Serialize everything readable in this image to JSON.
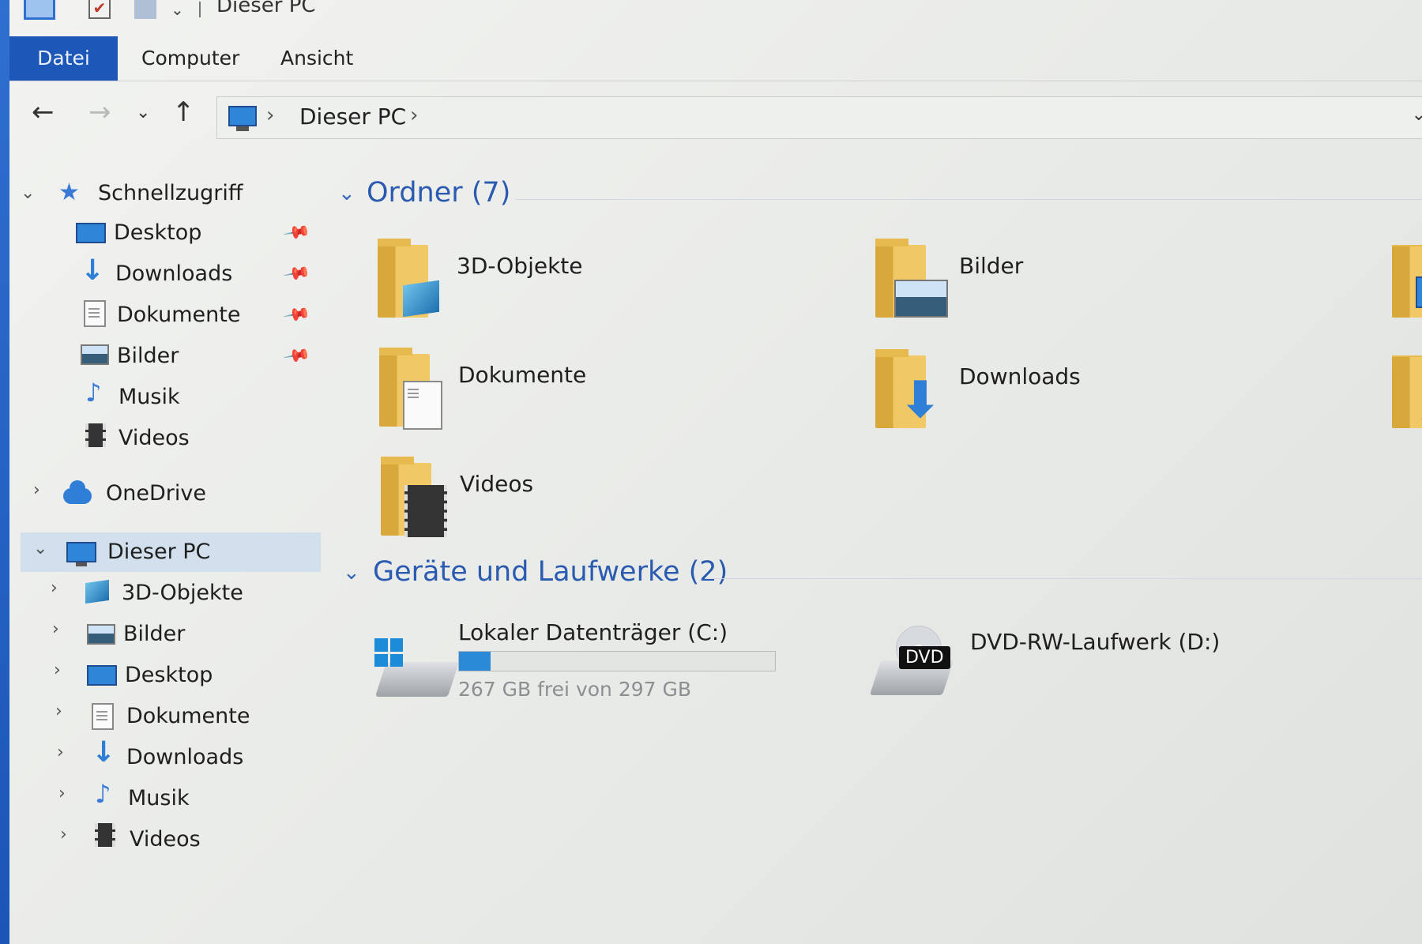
{
  "window": {
    "title": "Dieser PC"
  },
  "ribbon": {
    "file_tab": "Datei",
    "tabs": [
      "Computer",
      "Ansicht"
    ]
  },
  "address": {
    "path": [
      "Dieser PC"
    ],
    "icon": "this-pc-icon"
  },
  "sidebar": {
    "quick_access": {
      "label": "Schnellzugriff",
      "items": [
        {
          "label": "Desktop",
          "icon": "desktop-icon",
          "pinned": true
        },
        {
          "label": "Downloads",
          "icon": "downloads-icon",
          "pinned": true
        },
        {
          "label": "Dokumente",
          "icon": "documents-icon",
          "pinned": true
        },
        {
          "label": "Bilder",
          "icon": "pictures-icon",
          "pinned": true
        },
        {
          "label": "Musik",
          "icon": "music-icon",
          "pinned": false
        },
        {
          "label": "Videos",
          "icon": "videos-icon",
          "pinned": false
        }
      ]
    },
    "onedrive": {
      "label": "OneDrive"
    },
    "this_pc": {
      "label": "Dieser PC",
      "items": [
        "3D-Objekte",
        "Bilder",
        "Desktop",
        "Dokumente",
        "Downloads",
        "Musik",
        "Videos"
      ]
    }
  },
  "content": {
    "folders": {
      "heading": "Ordner (7)",
      "items": [
        "3D-Objekte",
        "Bilder",
        "Dokumente",
        "Downloads",
        "Videos"
      ]
    },
    "devices": {
      "heading": "Geräte und Laufwerke (2)",
      "drives": [
        {
          "label": "Lokaler Datenträger (C:)",
          "free_text": "267 GB frei von 297 GB",
          "used_fraction": 0.101
        },
        {
          "label": "DVD-RW-Laufwerk (D:)",
          "badge": "DVD"
        }
      ]
    }
  },
  "colors": {
    "accent": "#1d57b7",
    "group_heading": "#2a5bb0",
    "selection": "#d2dfec",
    "usage_bar": "#2b8ad8"
  }
}
